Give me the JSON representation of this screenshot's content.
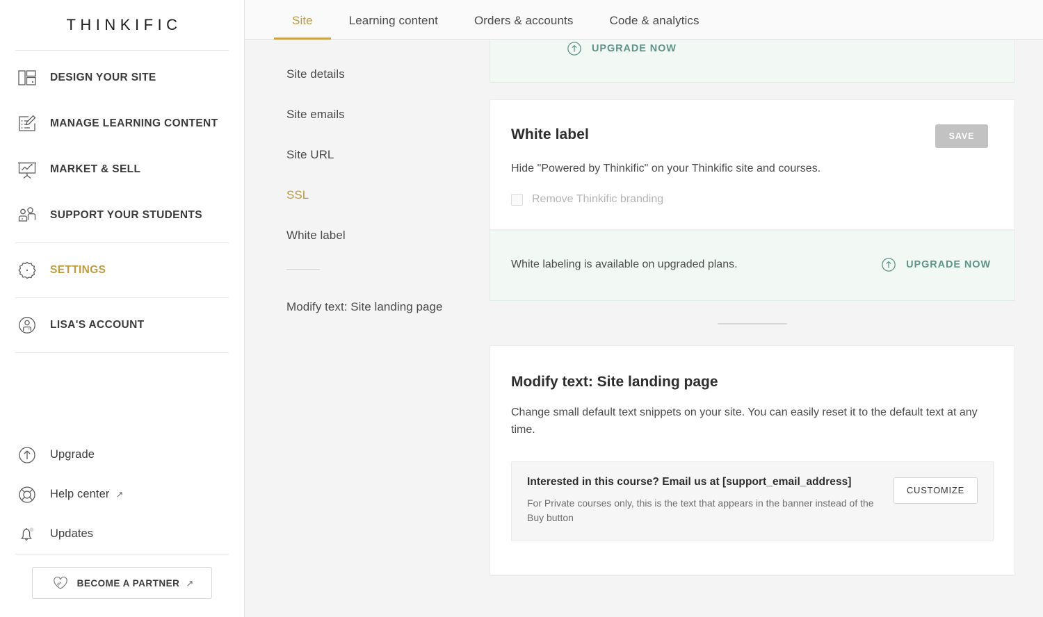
{
  "brand": {
    "logo_text": "THINKIFIC",
    "accent_gold": "#bf9b3f",
    "accent_teal": "#5f938a",
    "banner_bg": "#f2f9f5"
  },
  "sidebar": {
    "primary_items": [
      {
        "label": "DESIGN YOUR SITE",
        "icon": "layout-icon",
        "active": false
      },
      {
        "label": "MANAGE LEARNING CONTENT",
        "icon": "edit-document-icon",
        "active": false
      },
      {
        "label": "MARKET & SELL",
        "icon": "presentation-chart-icon",
        "active": false
      },
      {
        "label": "SUPPORT YOUR STUDENTS",
        "icon": "people-icon",
        "active": false
      },
      {
        "label": "SETTINGS",
        "icon": "gear-icon",
        "active": true
      },
      {
        "label": "LISA'S ACCOUNT",
        "icon": "user-circle-icon",
        "active": false
      }
    ],
    "secondary_items": [
      {
        "label": "Upgrade",
        "icon": "arrow-up-circle-icon",
        "external": false
      },
      {
        "label": "Help center",
        "icon": "life-ring-icon",
        "external": true,
        "external_glyph": "↗"
      },
      {
        "label": "Updates",
        "icon": "bell-icon",
        "external": false,
        "has_badge": true
      }
    ],
    "partner_button": {
      "label": "BECOME A PARTNER",
      "icon": "handshake-heart-icon",
      "external_glyph": "↗"
    }
  },
  "tabs": [
    {
      "label": "Site",
      "active": true
    },
    {
      "label": "Learning content",
      "active": false
    },
    {
      "label": "Orders & accounts",
      "active": false
    },
    {
      "label": "Code & analytics",
      "active": false
    }
  ],
  "submenu": {
    "items": [
      {
        "label": "Site details",
        "active": false
      },
      {
        "label": "Site emails",
        "active": false
      },
      {
        "label": "Site URL",
        "active": false
      },
      {
        "label": "SSL",
        "active": true
      },
      {
        "label": "White label",
        "active": false
      }
    ],
    "footer_items": [
      {
        "label": "Modify text: Site landing page",
        "active": false
      }
    ]
  },
  "content": {
    "top_banner": {
      "upgrade_label": "UPGRADE NOW",
      "icon": "arrow-up-circle-icon"
    },
    "white_label_card": {
      "title": "White label",
      "save_label": "SAVE",
      "save_disabled": true,
      "description": "Hide \"Powered by Thinkific\" on your Thinkific site and courses.",
      "checkbox_label": "Remove Thinkific branding",
      "checkbox_checked": false,
      "checkbox_disabled": true
    },
    "white_label_banner": {
      "message": "White labeling is available on upgraded plans.",
      "upgrade_label": "UPGRADE NOW",
      "icon": "arrow-up-circle-icon"
    },
    "modify_text_card": {
      "title": "Modify text: Site landing page",
      "description": "Change small default text snippets on your site. You can easily reset it to the default text at any time.",
      "snippets": [
        {
          "title": "Interested in this course? Email us at [support_email_address]",
          "subtitle": "For Private courses only, this is the text that appears in the banner instead of the Buy button",
          "button_label": "CUSTOMIZE"
        }
      ]
    }
  }
}
